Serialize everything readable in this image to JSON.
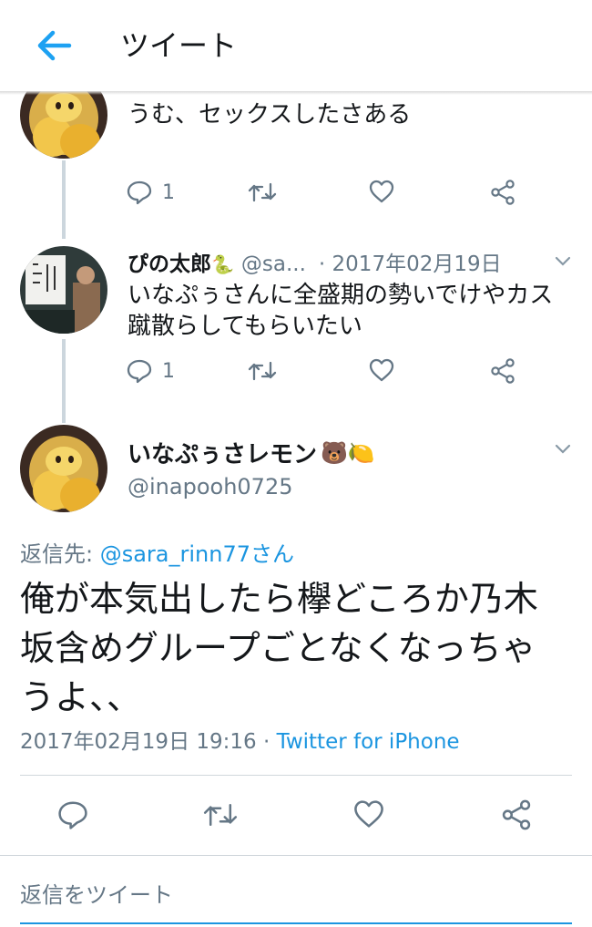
{
  "header": {
    "title": "ツイート",
    "back_icon": "arrow-left-icon"
  },
  "tweets": [
    {
      "text": "うむ、セックスしたさある",
      "actions": {
        "reply_count": "1",
        "retweet_count": "",
        "like_count": ""
      }
    },
    {
      "name": "ぴの太郎",
      "name_emoji": "🐍",
      "handle": "@sa...",
      "date": "· 2017年02月19日",
      "text_line1": "いなぷぅさんに全盛期の勢いでけやカス",
      "text_line2": "蹴散らしてもらいたい",
      "actions": {
        "reply_count": "1",
        "retweet_count": "",
        "like_count": ""
      }
    }
  ],
  "main": {
    "name": "いなぷぅさレモン",
    "name_emoji": "🐻🍋",
    "handle": "@inapooh0725",
    "reply_prefix": "返信先: ",
    "reply_target": "@sara_rinn77さん",
    "text_line1": "俺が本気出したら欅どころか乃木",
    "text_line2": "坂含めグループごとなくなっちゃ",
    "text_line3": "うよ、、",
    "timestamp": "2017年02月19日 19:16 · ",
    "source": "Twitter for iPhone"
  },
  "reply_box": {
    "placeholder": "返信をツイート"
  },
  "colors": {
    "accent": "#1b95e0",
    "muted": "#657786",
    "thread_line": "#ccd6dd"
  }
}
